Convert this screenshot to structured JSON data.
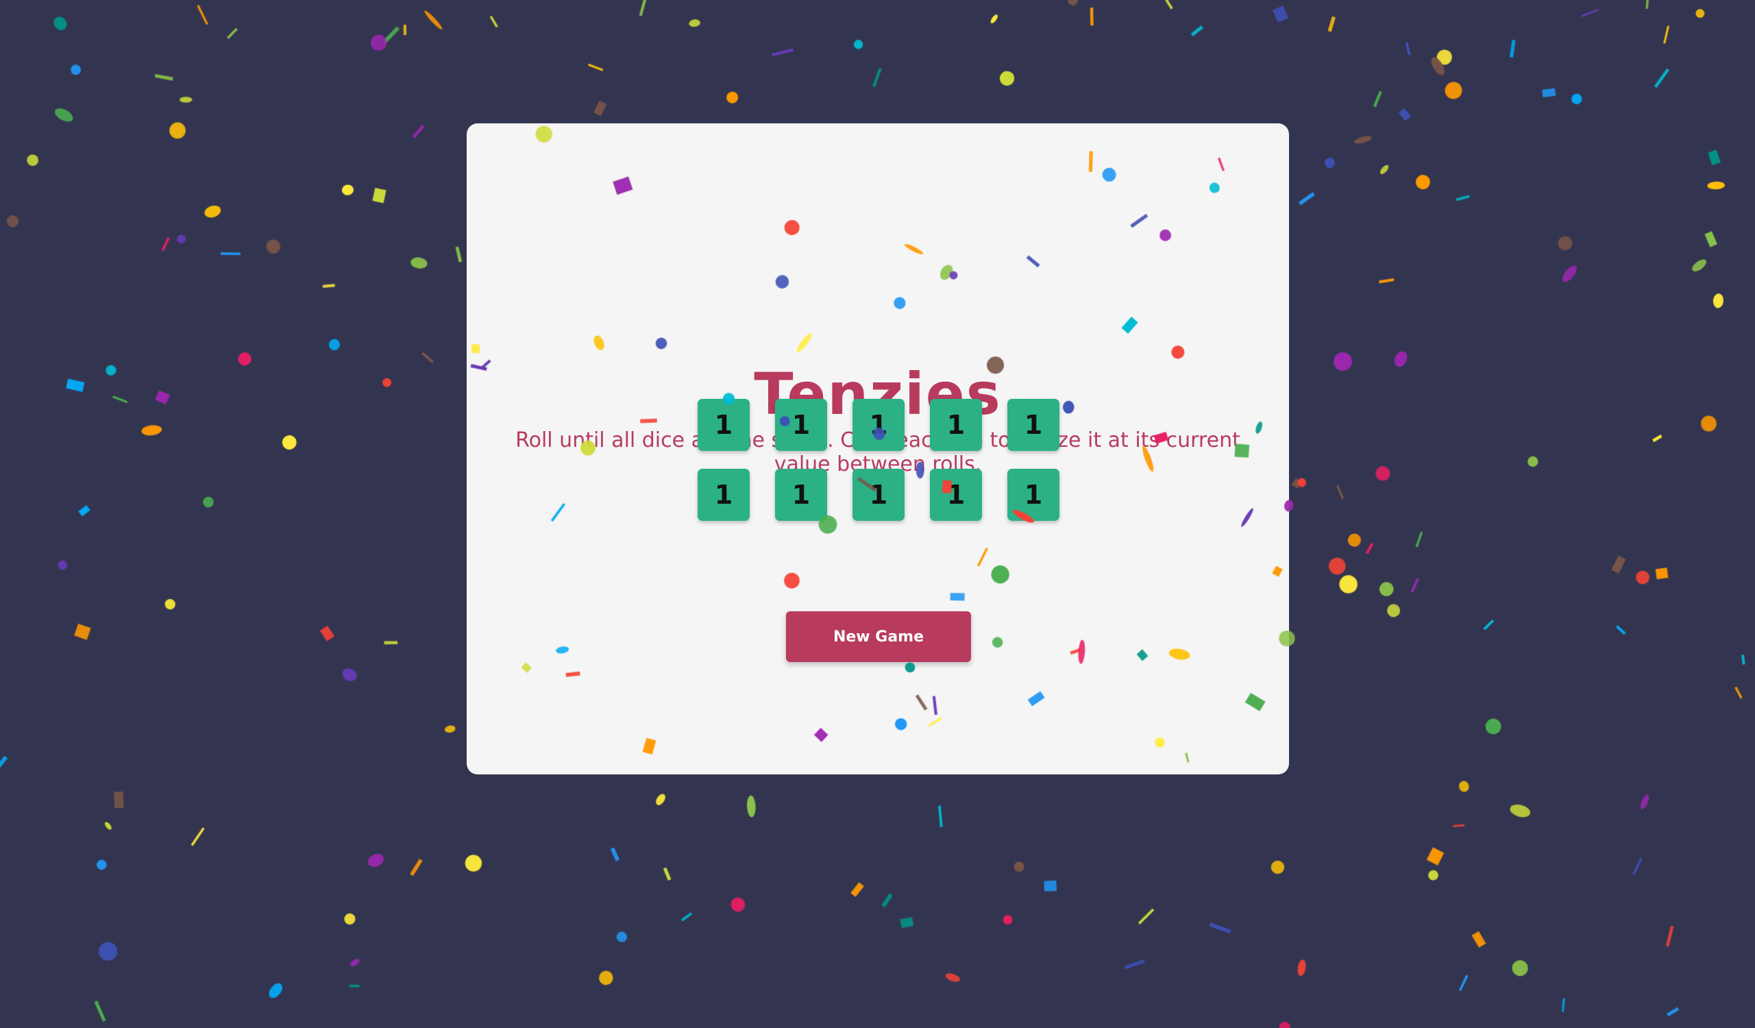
{
  "game": {
    "title": "Tenzies",
    "instructions": "Roll until all dice are the same. Click each die to freeze it at its current value between rolls.",
    "dice": [
      {
        "value": "1"
      },
      {
        "value": "1"
      },
      {
        "value": "1"
      },
      {
        "value": "1"
      },
      {
        "value": "1"
      },
      {
        "value": "1"
      },
      {
        "value": "1"
      },
      {
        "value": "1"
      },
      {
        "value": "1"
      },
      {
        "value": "1"
      }
    ],
    "button_label": "New Game"
  },
  "colors": {
    "background": "#333550",
    "card": "#f5f5f5",
    "accent": "#b83b5e",
    "die": "#2bb185"
  },
  "confetti_colors": [
    "#f44336",
    "#e91e63",
    "#9c27b0",
    "#673ab7",
    "#3f51b5",
    "#2196f3",
    "#03a9f4",
    "#00bcd4",
    "#009688",
    "#4caf50",
    "#8bc34a",
    "#cddc39",
    "#ffeb3b",
    "#ffc107",
    "#ff9800",
    "#795548"
  ]
}
